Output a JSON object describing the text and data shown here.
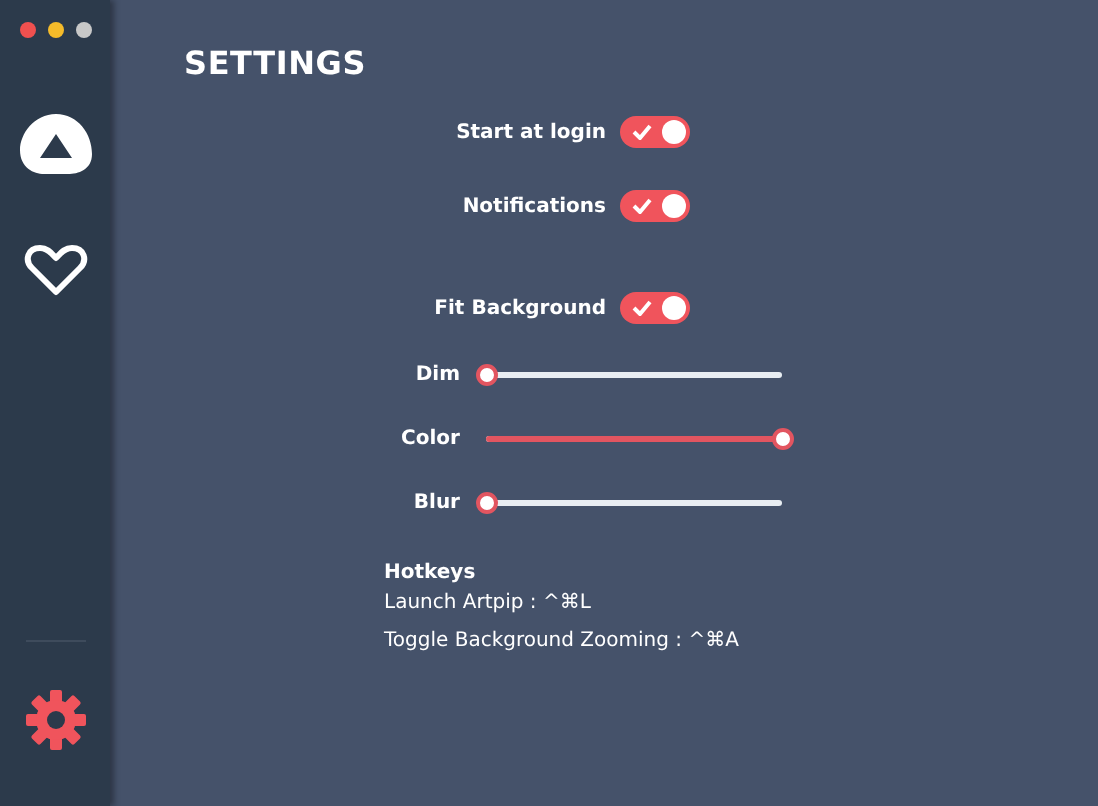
{
  "sidebar": {
    "items": [
      {
        "kind": "logo",
        "selected": false
      },
      {
        "kind": "favorites",
        "selected": false
      },
      {
        "kind": "settings",
        "selected": true
      }
    ]
  },
  "title": "SETTINGS",
  "toggle_groups": [
    [
      {
        "label": "Start at login",
        "on": true
      },
      {
        "label": "Notifications",
        "on": true
      }
    ],
    [
      {
        "label": "Fit Background",
        "on": true
      }
    ]
  ],
  "sliders": [
    {
      "label": "Dim",
      "level": 0
    },
    {
      "label": "Color",
      "level": 1
    },
    {
      "label": "Blur",
      "level": 0
    }
  ],
  "hotkeys": {
    "heading": "Hotkeys",
    "items": [
      "Launch Artpip : ^⌘L",
      "Toggle Background Zooming : ^⌘A"
    ]
  }
}
